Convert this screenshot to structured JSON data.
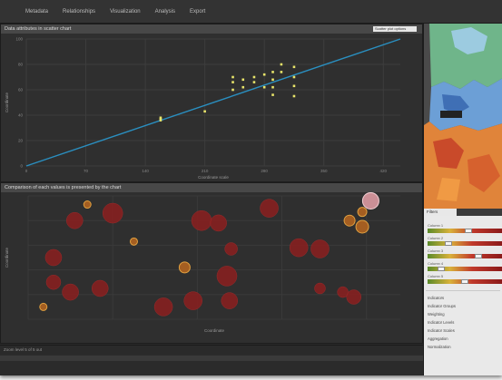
{
  "menu": {
    "items": [
      "Metadata",
      "Relationships",
      "Visualization",
      "Analysis",
      "Export"
    ]
  },
  "scatter_panel": {
    "title": "Data attributes in scatter chart",
    "button_label": "Scatter plot options"
  },
  "bubble_panel": {
    "title": "Comparison of each values is presented by the chart"
  },
  "status": {
    "text": "Zoom level 5 of 5 out"
  },
  "sidebar": {
    "tab_label": "Filters",
    "items": [
      "Indicators",
      "Indicator Groups",
      "Weighting",
      "Indicator Levels",
      "Indicator Scales",
      "Aggregation",
      "Normalization"
    ],
    "sliders": [
      {
        "label": "Column 1",
        "level": 0.55
      },
      {
        "label": "Column 2",
        "level": 0.25
      },
      {
        "label": "Column 3",
        "level": 0.7
      },
      {
        "label": "Column 4",
        "level": 0.15
      },
      {
        "label": "Column 5",
        "level": 0.5
      }
    ]
  },
  "colors": {
    "accent_line": "#2a8fc0",
    "scatter_point": "#e8e46a",
    "bubble_dark": "#8b1f1f",
    "bubble_orange": "#c06a1c"
  },
  "chart_data": [
    {
      "type": "scatter",
      "title": "Data attributes in scatter chart",
      "xlabel": "Coordinate scale",
      "ylabel": "Coordinate",
      "xlim": [
        0,
        440
      ],
      "ylim": [
        0,
        100
      ],
      "x_ticks": [
        0,
        70,
        140,
        210,
        280,
        350,
        420
      ],
      "y_ticks": [
        0,
        20,
        40,
        60,
        80,
        100
      ],
      "points": [
        {
          "x": 158,
          "y": 38
        },
        {
          "x": 158,
          "y": 37
        },
        {
          "x": 158,
          "y": 36
        },
        {
          "x": 210,
          "y": 43
        },
        {
          "x": 243,
          "y": 66
        },
        {
          "x": 243,
          "y": 70
        },
        {
          "x": 243,
          "y": 60
        },
        {
          "x": 255,
          "y": 68
        },
        {
          "x": 255,
          "y": 62
        },
        {
          "x": 268,
          "y": 70
        },
        {
          "x": 268,
          "y": 66
        },
        {
          "x": 280,
          "y": 72
        },
        {
          "x": 280,
          "y": 62
        },
        {
          "x": 290,
          "y": 74
        },
        {
          "x": 290,
          "y": 68
        },
        {
          "x": 290,
          "y": 62
        },
        {
          "x": 290,
          "y": 56
        },
        {
          "x": 300,
          "y": 80
        },
        {
          "x": 300,
          "y": 74
        },
        {
          "x": 315,
          "y": 78
        },
        {
          "x": 315,
          "y": 70
        },
        {
          "x": 315,
          "y": 63
        },
        {
          "x": 315,
          "y": 55
        }
      ],
      "trendline": [
        [
          0,
          0
        ],
        [
          440,
          100
        ]
      ]
    },
    {
      "type": "bubble",
      "title": "Comparison of each values is presented by the chart",
      "xlabel": "Coordinate",
      "ylabel": "Coordinate",
      "xlim": [
        0,
        440
      ],
      "ylim": [
        0,
        100
      ],
      "points": [
        {
          "x": 55,
          "y": 80,
          "r": 9,
          "color": "dark"
        },
        {
          "x": 100,
          "y": 86,
          "r": 11,
          "color": "dark"
        },
        {
          "x": 70,
          "y": 93,
          "r": 4,
          "color": "orange"
        },
        {
          "x": 125,
          "y": 63,
          "r": 4,
          "color": "orange"
        },
        {
          "x": 30,
          "y": 50,
          "r": 9,
          "color": "dark"
        },
        {
          "x": 30,
          "y": 30,
          "r": 8,
          "color": "dark"
        },
        {
          "x": 50,
          "y": 22,
          "r": 9,
          "color": "dark"
        },
        {
          "x": 85,
          "y": 25,
          "r": 9,
          "color": "dark"
        },
        {
          "x": 18,
          "y": 10,
          "r": 4,
          "color": "orange"
        },
        {
          "x": 160,
          "y": 10,
          "r": 10,
          "color": "dark"
        },
        {
          "x": 195,
          "y": 15,
          "r": 10,
          "color": "dark"
        },
        {
          "x": 185,
          "y": 42,
          "r": 6,
          "color": "orange"
        },
        {
          "x": 205,
          "y": 80,
          "r": 11,
          "color": "dark"
        },
        {
          "x": 225,
          "y": 78,
          "r": 9,
          "color": "dark"
        },
        {
          "x": 240,
          "y": 57,
          "r": 7,
          "color": "dark"
        },
        {
          "x": 235,
          "y": 35,
          "r": 11,
          "color": "dark"
        },
        {
          "x": 238,
          "y": 15,
          "r": 9,
          "color": "dark"
        },
        {
          "x": 285,
          "y": 90,
          "r": 10,
          "color": "dark"
        },
        {
          "x": 320,
          "y": 58,
          "r": 10,
          "color": "dark"
        },
        {
          "x": 345,
          "y": 57,
          "r": 10,
          "color": "dark"
        },
        {
          "x": 345,
          "y": 25,
          "r": 6,
          "color": "dark"
        },
        {
          "x": 372,
          "y": 22,
          "r": 6,
          "color": "dark"
        },
        {
          "x": 385,
          "y": 18,
          "r": 8,
          "color": "dark"
        },
        {
          "x": 380,
          "y": 80,
          "r": 6,
          "color": "orange"
        },
        {
          "x": 395,
          "y": 75,
          "r": 7,
          "color": "orange"
        },
        {
          "x": 395,
          "y": 87,
          "r": 5,
          "color": "orange"
        },
        {
          "x": 405,
          "y": 96,
          "r": 9,
          "color": "pink"
        }
      ]
    }
  ]
}
